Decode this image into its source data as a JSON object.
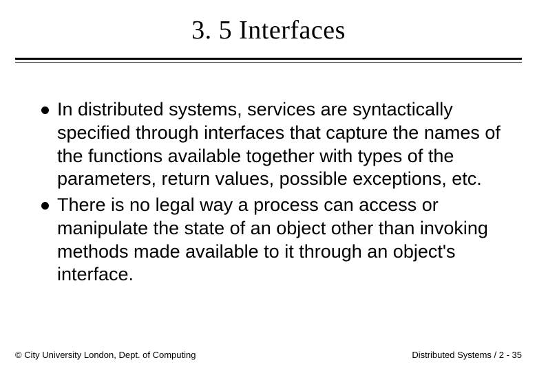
{
  "title": "3. 5 Interfaces",
  "bullets": [
    "In distributed systems, services are syntactically specified through interfaces that capture the names of the functions available together with types of the parameters, return values, possible exceptions, etc.",
    "There is no legal way a process can access or manipulate the state of an object other than invoking methods made available to it through an object's interface."
  ],
  "footer": {
    "left": "© City University London, Dept. of Computing",
    "right": "Distributed Systems / 2 - 35"
  }
}
